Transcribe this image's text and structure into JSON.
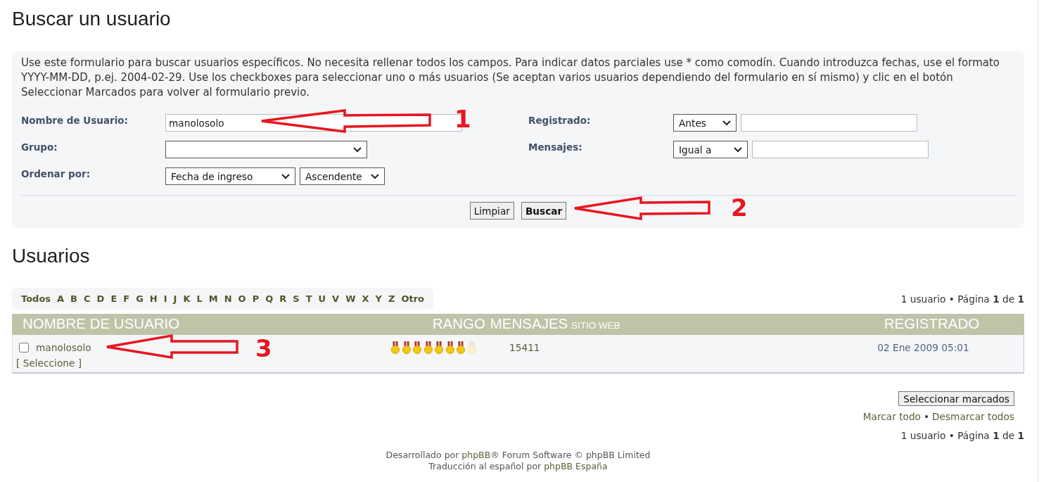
{
  "page_title": "Buscar un usuario",
  "search_form": {
    "description": "Use este formulario para buscar usuarios específicos. No necesita rellenar todos los campos. Para indicar datos parciales use * como comodín. Cuando introduzca fechas, use el formato YYYY-MM-DD, p.ej. 2004-02-29. Use los checkboxes para seleccionar uno o más usuarios (Se aceptan varios usuarios dependiendo del formulario en sí mismo) y clic en el botón Seleccionar Marcados para volver al formulario previo.",
    "columns": [
      [
        {
          "label": "Nombre de Usuario:",
          "controls": [
            {
              "kind": "text",
              "value": "manolosolo"
            }
          ]
        },
        {
          "label": "Grupo:",
          "controls": [
            {
              "kind": "select"
            }
          ]
        },
        {
          "label": "Ordenar por:",
          "controls": [
            {
              "kind": "select",
              "value": "Fecha de ingreso"
            },
            {
              "kind": "select",
              "value": "Ascendente"
            }
          ]
        }
      ],
      [
        {
          "label": "Registrado:",
          "controls": [
            {
              "kind": "select",
              "value": "Antes"
            },
            {
              "kind": "text"
            }
          ]
        },
        {
          "label": "Mensajes:",
          "controls": [
            {
              "kind": "select",
              "value": "Igual a"
            },
            {
              "kind": "text"
            }
          ]
        }
      ]
    ],
    "buttons": [
      {
        "label": "Limpiar",
        "kind": "reset"
      },
      {
        "label": "Buscar",
        "kind": "submit"
      }
    ]
  },
  "results_title": "Usuarios",
  "letter_filter": [
    "Todos",
    "A",
    "B",
    "C",
    "D",
    "E",
    "F",
    "G",
    "H",
    "I",
    "J",
    "K",
    "L",
    "M",
    "N",
    "O",
    "P",
    "Q",
    "R",
    "S",
    "T",
    "U",
    "V",
    "W",
    "X",
    "Y",
    "Z",
    "Otro"
  ],
  "pagination_top": "1 usuario • Página **1** de **1**",
  "table": {
    "columns": [
      "NOMBRE DE USUARIO",
      "RANGO",
      "MENSAJES",
      "SITIO WEB",
      "REGISTRADO"
    ],
    "rows": [
      {
        "checked": false,
        "username": "manolosolo",
        "select_link": "[ Seleccione ]",
        "stars": 7,
        "posts": "15411",
        "registered": "02 Ene 2009 05:01"
      }
    ]
  },
  "select_marked_button": "Seleccionar marcados",
  "mark_links": {
    "mark_all": "Marcar todo",
    "separator": "•",
    "unmark_all": "Desmarcar todos"
  },
  "pagination_bottom": "1 usuario • Página **1** de **1**",
  "footer": {
    "lines": [
      {
        "before": "Desarrollado por ",
        "link": "phpBB",
        "after": "® Forum Software © phpBB Limited"
      },
      {
        "before": "Traducción al español por ",
        "link": "phpBB España"
      }
    ]
  },
  "annotations": [
    {
      "label": "1"
    },
    {
      "label": "2"
    },
    {
      "label": "3"
    }
  ]
}
